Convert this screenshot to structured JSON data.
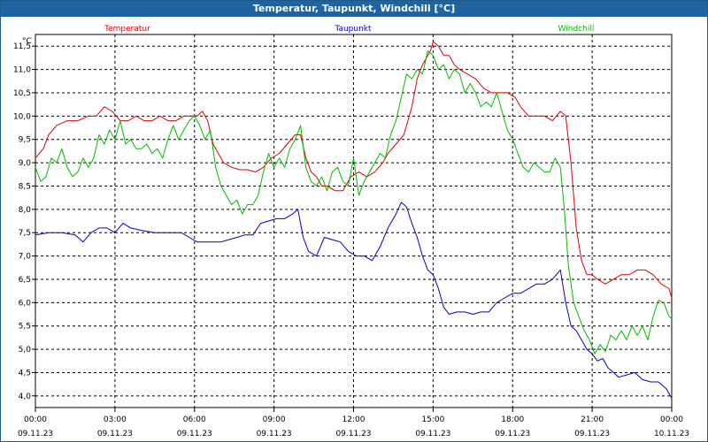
{
  "window": {
    "title": "Temperatur, Taupunkt, Windchill [°C]"
  },
  "chart_data": {
    "type": "line",
    "title": "Temperatur, Taupunkt, Windchill [°C]",
    "ylabel": "°C",
    "ylim": [
      3.75,
      11.75
    ],
    "xlim": [
      0,
      24
    ],
    "grid": true,
    "legend_position": "top",
    "y_ticks": [
      "4,0",
      "4,5",
      "5,0",
      "5,5",
      "6,0",
      "6,5",
      "7,0",
      "7,5",
      "8,0",
      "8,5",
      "9,0",
      "9,5",
      "10,0",
      "10,5",
      "11,0",
      "11,5"
    ],
    "y_tick_values": [
      4.0,
      4.5,
      5.0,
      5.5,
      6.0,
      6.5,
      7.0,
      7.5,
      8.0,
      8.5,
      9.0,
      9.5,
      10.0,
      10.5,
      11.0,
      11.5
    ],
    "x_ticks": [
      {
        "time": "00:00",
        "date": "09.11.23",
        "h": 0
      },
      {
        "time": "03:00",
        "date": "09.11.23",
        "h": 3
      },
      {
        "time": "06:00",
        "date": "09.11.23",
        "h": 6
      },
      {
        "time": "09:00",
        "date": "09.11.23",
        "h": 9
      },
      {
        "time": "12:00",
        "date": "09.11.23",
        "h": 12
      },
      {
        "time": "15:00",
        "date": "09.11.23",
        "h": 15
      },
      {
        "time": "18:00",
        "date": "09.11.23",
        "h": 18
      },
      {
        "time": "21:00",
        "date": "09.11.23",
        "h": 21
      },
      {
        "time": "00:00",
        "date": "10.11.23",
        "h": 24
      }
    ],
    "series": [
      {
        "name": "Temperatur",
        "color": "#e00000",
        "points": [
          [
            0,
            9.1
          ],
          [
            0.3,
            9.3
          ],
          [
            0.5,
            9.6
          ],
          [
            0.8,
            9.8
          ],
          [
            1.2,
            9.9
          ],
          [
            1.6,
            9.9
          ],
          [
            2.0,
            10.0
          ],
          [
            2.3,
            10.0
          ],
          [
            2.6,
            10.2
          ],
          [
            2.9,
            10.1
          ],
          [
            3.2,
            9.9
          ],
          [
            3.5,
            9.9
          ],
          [
            3.8,
            10.0
          ],
          [
            4.1,
            9.9
          ],
          [
            4.4,
            9.9
          ],
          [
            4.7,
            10.0
          ],
          [
            5.0,
            9.9
          ],
          [
            5.3,
            9.9
          ],
          [
            5.6,
            10.0
          ],
          [
            5.9,
            10.0
          ],
          [
            6.1,
            10.0
          ],
          [
            6.3,
            10.1
          ],
          [
            6.5,
            9.9
          ],
          [
            6.7,
            9.4
          ],
          [
            6.9,
            9.2
          ],
          [
            7.1,
            9.0
          ],
          [
            7.4,
            8.9
          ],
          [
            7.7,
            8.85
          ],
          [
            8.0,
            8.85
          ],
          [
            8.3,
            8.8
          ],
          [
            8.6,
            8.9
          ],
          [
            8.9,
            9.1
          ],
          [
            9.2,
            9.2
          ],
          [
            9.5,
            9.4
          ],
          [
            9.8,
            9.6
          ],
          [
            10.0,
            9.6
          ],
          [
            10.2,
            9.1
          ],
          [
            10.4,
            8.8
          ],
          [
            10.6,
            8.7
          ],
          [
            10.8,
            8.5
          ],
          [
            11.0,
            8.5
          ],
          [
            11.3,
            8.4
          ],
          [
            11.6,
            8.4
          ],
          [
            11.9,
            8.7
          ],
          [
            12.2,
            8.8
          ],
          [
            12.5,
            8.7
          ],
          [
            12.8,
            8.8
          ],
          [
            13.1,
            9.0
          ],
          [
            13.3,
            9.2
          ],
          [
            13.6,
            9.4
          ],
          [
            13.9,
            9.6
          ],
          [
            14.2,
            10.2
          ],
          [
            14.4,
            10.8
          ],
          [
            14.6,
            11.1
          ],
          [
            14.9,
            11.4
          ],
          [
            15.0,
            11.6
          ],
          [
            15.2,
            11.5
          ],
          [
            15.4,
            11.3
          ],
          [
            15.6,
            11.3
          ],
          [
            15.8,
            11.1
          ],
          [
            16.0,
            11.0
          ],
          [
            16.3,
            10.9
          ],
          [
            16.6,
            10.8
          ],
          [
            16.9,
            10.6
          ],
          [
            17.2,
            10.5
          ],
          [
            17.5,
            10.5
          ],
          [
            17.8,
            10.5
          ],
          [
            18.1,
            10.4
          ],
          [
            18.3,
            10.2
          ],
          [
            18.6,
            10.0
          ],
          [
            18.9,
            10.0
          ],
          [
            19.2,
            10.0
          ],
          [
            19.5,
            9.9
          ],
          [
            19.8,
            10.1
          ],
          [
            20.0,
            10.0
          ],
          [
            20.2,
            9.0
          ],
          [
            20.4,
            7.6
          ],
          [
            20.6,
            6.9
          ],
          [
            20.8,
            6.6
          ],
          [
            21.0,
            6.6
          ],
          [
            21.2,
            6.5
          ],
          [
            21.5,
            6.4
          ],
          [
            21.8,
            6.5
          ],
          [
            22.1,
            6.6
          ],
          [
            22.4,
            6.6
          ],
          [
            22.7,
            6.7
          ],
          [
            23.0,
            6.7
          ],
          [
            23.3,
            6.6
          ],
          [
            23.6,
            6.4
          ],
          [
            23.9,
            6.3
          ],
          [
            24.0,
            6.1
          ]
        ]
      },
      {
        "name": "Taupunkt",
        "color": "#0000cc",
        "points": [
          [
            0,
            7.45
          ],
          [
            0.5,
            7.5
          ],
          [
            1.0,
            7.5
          ],
          [
            1.5,
            7.45
          ],
          [
            1.8,
            7.3
          ],
          [
            2.1,
            7.5
          ],
          [
            2.4,
            7.6
          ],
          [
            2.7,
            7.6
          ],
          [
            3.0,
            7.5
          ],
          [
            3.3,
            7.7
          ],
          [
            3.6,
            7.6
          ],
          [
            4.0,
            7.55
          ],
          [
            4.5,
            7.5
          ],
          [
            5.0,
            7.5
          ],
          [
            5.5,
            7.5
          ],
          [
            5.8,
            7.4
          ],
          [
            6.1,
            7.3
          ],
          [
            6.4,
            7.3
          ],
          [
            6.7,
            7.3
          ],
          [
            7.0,
            7.3
          ],
          [
            7.3,
            7.35
          ],
          [
            7.6,
            7.4
          ],
          [
            7.9,
            7.45
          ],
          [
            8.2,
            7.45
          ],
          [
            8.5,
            7.7
          ],
          [
            8.8,
            7.75
          ],
          [
            9.1,
            7.8
          ],
          [
            9.4,
            7.8
          ],
          [
            9.7,
            7.9
          ],
          [
            9.9,
            8.0
          ],
          [
            10.1,
            7.4
          ],
          [
            10.3,
            7.1
          ],
          [
            10.6,
            7.0
          ],
          [
            10.9,
            7.4
          ],
          [
            11.2,
            7.35
          ],
          [
            11.5,
            7.3
          ],
          [
            11.8,
            7.1
          ],
          [
            12.1,
            7.0
          ],
          [
            12.4,
            7.0
          ],
          [
            12.7,
            6.9
          ],
          [
            13.0,
            7.2
          ],
          [
            13.3,
            7.6
          ],
          [
            13.6,
            7.9
          ],
          [
            13.8,
            8.15
          ],
          [
            14.0,
            8.05
          ],
          [
            14.2,
            7.7
          ],
          [
            14.4,
            7.4
          ],
          [
            14.6,
            7.0
          ],
          [
            14.8,
            6.7
          ],
          [
            15.0,
            6.6
          ],
          [
            15.2,
            6.3
          ],
          [
            15.4,
            5.9
          ],
          [
            15.6,
            5.75
          ],
          [
            15.9,
            5.8
          ],
          [
            16.2,
            5.8
          ],
          [
            16.5,
            5.75
          ],
          [
            16.8,
            5.8
          ],
          [
            17.1,
            5.8
          ],
          [
            17.4,
            6.0
          ],
          [
            17.7,
            6.1
          ],
          [
            18.0,
            6.2
          ],
          [
            18.3,
            6.2
          ],
          [
            18.6,
            6.3
          ],
          [
            18.9,
            6.4
          ],
          [
            19.2,
            6.4
          ],
          [
            19.5,
            6.5
          ],
          [
            19.8,
            6.7
          ],
          [
            20.0,
            6.0
          ],
          [
            20.2,
            5.5
          ],
          [
            20.4,
            5.4
          ],
          [
            20.6,
            5.2
          ],
          [
            20.8,
            5.0
          ],
          [
            21.0,
            4.9
          ],
          [
            21.2,
            4.75
          ],
          [
            21.4,
            4.8
          ],
          [
            21.6,
            4.6
          ],
          [
            21.8,
            4.5
          ],
          [
            22.0,
            4.4
          ],
          [
            22.3,
            4.45
          ],
          [
            22.6,
            4.5
          ],
          [
            22.9,
            4.35
          ],
          [
            23.2,
            4.3
          ],
          [
            23.5,
            4.3
          ],
          [
            23.8,
            4.15
          ],
          [
            24.0,
            3.95
          ]
        ]
      },
      {
        "name": "Windchill",
        "color": "#00bb00",
        "points": [
          [
            0,
            8.9
          ],
          [
            0.2,
            8.6
          ],
          [
            0.4,
            8.7
          ],
          [
            0.6,
            9.1
          ],
          [
            0.8,
            9.0
          ],
          [
            1.0,
            9.3
          ],
          [
            1.2,
            8.9
          ],
          [
            1.4,
            8.7
          ],
          [
            1.6,
            8.8
          ],
          [
            1.8,
            9.1
          ],
          [
            2.0,
            8.9
          ],
          [
            2.2,
            9.1
          ],
          [
            2.4,
            9.6
          ],
          [
            2.6,
            9.4
          ],
          [
            2.8,
            9.7
          ],
          [
            3.0,
            9.5
          ],
          [
            3.2,
            9.9
          ],
          [
            3.4,
            9.4
          ],
          [
            3.6,
            9.5
          ],
          [
            3.8,
            9.3
          ],
          [
            4.0,
            9.3
          ],
          [
            4.2,
            9.4
          ],
          [
            4.4,
            9.2
          ],
          [
            4.6,
            9.3
          ],
          [
            4.8,
            9.1
          ],
          [
            5.0,
            9.5
          ],
          [
            5.2,
            9.8
          ],
          [
            5.4,
            9.5
          ],
          [
            5.6,
            9.7
          ],
          [
            5.8,
            9.9
          ],
          [
            6.0,
            10.0
          ],
          [
            6.2,
            9.8
          ],
          [
            6.4,
            9.5
          ],
          [
            6.6,
            9.7
          ],
          [
            6.8,
            8.9
          ],
          [
            7.0,
            8.5
          ],
          [
            7.2,
            8.3
          ],
          [
            7.4,
            8.1
          ],
          [
            7.6,
            8.2
          ],
          [
            7.8,
            7.9
          ],
          [
            8.0,
            8.1
          ],
          [
            8.2,
            8.1
          ],
          [
            8.4,
            8.3
          ],
          [
            8.6,
            8.8
          ],
          [
            8.8,
            9.2
          ],
          [
            9.0,
            8.9
          ],
          [
            9.2,
            9.1
          ],
          [
            9.4,
            8.9
          ],
          [
            9.6,
            9.3
          ],
          [
            9.8,
            9.5
          ],
          [
            10.0,
            9.8
          ],
          [
            10.2,
            8.9
          ],
          [
            10.4,
            8.6
          ],
          [
            10.6,
            8.5
          ],
          [
            10.8,
            8.7
          ],
          [
            11.0,
            8.4
          ],
          [
            11.2,
            8.8
          ],
          [
            11.4,
            8.9
          ],
          [
            11.6,
            8.6
          ],
          [
            11.8,
            8.5
          ],
          [
            12.0,
            9.1
          ],
          [
            12.2,
            8.3
          ],
          [
            12.4,
            8.6
          ],
          [
            12.6,
            8.8
          ],
          [
            12.8,
            9.0
          ],
          [
            13.0,
            9.2
          ],
          [
            13.2,
            9.1
          ],
          [
            13.4,
            9.6
          ],
          [
            13.6,
            9.9
          ],
          [
            13.8,
            10.4
          ],
          [
            14.0,
            10.9
          ],
          [
            14.2,
            10.8
          ],
          [
            14.4,
            11.0
          ],
          [
            14.6,
            10.9
          ],
          [
            14.8,
            11.4
          ],
          [
            15.0,
            11.3
          ],
          [
            15.2,
            11.0
          ],
          [
            15.4,
            11.1
          ],
          [
            15.6,
            10.8
          ],
          [
            15.8,
            11.0
          ],
          [
            16.0,
            10.9
          ],
          [
            16.2,
            10.5
          ],
          [
            16.4,
            10.7
          ],
          [
            16.6,
            10.5
          ],
          [
            16.8,
            10.2
          ],
          [
            17.0,
            10.3
          ],
          [
            17.2,
            10.2
          ],
          [
            17.4,
            10.5
          ],
          [
            17.6,
            10.1
          ],
          [
            17.8,
            9.7
          ],
          [
            18.0,
            9.5
          ],
          [
            18.2,
            9.2
          ],
          [
            18.4,
            8.9
          ],
          [
            18.6,
            8.8
          ],
          [
            18.8,
            9.0
          ],
          [
            19.0,
            8.9
          ],
          [
            19.2,
            8.8
          ],
          [
            19.4,
            8.8
          ],
          [
            19.6,
            9.1
          ],
          [
            19.8,
            8.9
          ],
          [
            19.95,
            8.0
          ],
          [
            20.1,
            6.8
          ],
          [
            20.3,
            6.0
          ],
          [
            20.5,
            5.7
          ],
          [
            20.7,
            5.4
          ],
          [
            20.9,
            5.2
          ],
          [
            21.1,
            4.9
          ],
          [
            21.3,
            5.1
          ],
          [
            21.5,
            4.95
          ],
          [
            21.7,
            5.3
          ],
          [
            21.9,
            5.2
          ],
          [
            22.1,
            5.4
          ],
          [
            22.3,
            5.2
          ],
          [
            22.5,
            5.5
          ],
          [
            22.7,
            5.3
          ],
          [
            22.9,
            5.5
          ],
          [
            23.1,
            5.2
          ],
          [
            23.3,
            5.7
          ],
          [
            23.5,
            6.05
          ],
          [
            23.7,
            6.0
          ],
          [
            23.9,
            5.7
          ],
          [
            24.0,
            5.65
          ]
        ]
      }
    ]
  }
}
